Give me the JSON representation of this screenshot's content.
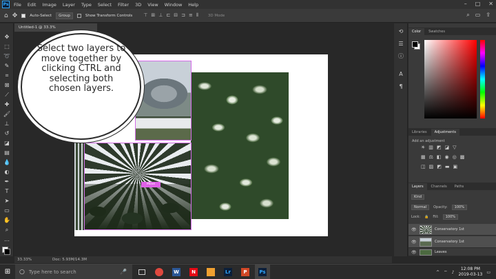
{
  "app": {
    "name": "Photoshop",
    "logo": "Ps",
    "menu": [
      "File",
      "Edit",
      "Image",
      "Layer",
      "Type",
      "Select",
      "Filter",
      "3D",
      "View",
      "Window",
      "Help"
    ],
    "window_controls": [
      "minimize",
      "maximize",
      "close"
    ]
  },
  "options_bar": {
    "auto_select_label": "Auto-Select",
    "auto_select_checked": true,
    "group_value": "Group",
    "show_transform_label": "Show Transform Controls",
    "mode_3d_label": "3D Mode"
  },
  "document": {
    "tab_title": "Untitled-1 @ 33.3%",
    "move_tag": "Move",
    "colors": {
      "selection": "#d36be8",
      "canvas": "#ffffff"
    }
  },
  "callout": {
    "text": "Select two layers to move together by clicking CTRL and selecting both chosen layers."
  },
  "status_bar": {
    "zoom": "33.33%",
    "doc_info": "Doc: 5.93M/14.3M"
  },
  "panels": {
    "color_tabs": [
      "Color",
      "Swatches"
    ],
    "adjust_tabs": [
      "Libraries",
      "Adjustments"
    ],
    "add_adjustment_label": "Add an adjustment",
    "layers_tabs": [
      "Layers",
      "Channels",
      "Paths"
    ],
    "kind_value": "Kind",
    "blend_mode": "Normal",
    "opacity_label": "Opacity:",
    "opacity_value": "100%",
    "lock_label": "Lock:",
    "fill_label": "Fill:",
    "fill_value": "100%",
    "layers": [
      {
        "name": "Conservatory 1st",
        "selected": true
      },
      {
        "name": "Conservatory 1st",
        "selected": true
      },
      {
        "name": "Leaves",
        "selected": false
      }
    ]
  },
  "taskbar": {
    "search_placeholder": "Type here to search",
    "apps": [
      {
        "icon": "chrome-icon",
        "color": "#e0483e",
        "label": ""
      },
      {
        "icon": "word-icon",
        "color": "#2b5797",
        "label": "W"
      },
      {
        "icon": "netflix-icon",
        "color": "#e50914",
        "label": "N"
      },
      {
        "icon": "files-icon",
        "color": "#f0a030",
        "label": ""
      },
      {
        "icon": "lightroom-icon",
        "color": "#0b1f3a",
        "label": "Lr"
      },
      {
        "icon": "powerpoint-icon",
        "color": "#d24726",
        "label": "P"
      },
      {
        "icon": "photoshop-icon",
        "color": "#0b1f3a",
        "label": "Ps"
      }
    ],
    "time": "12:08 PM",
    "date": "2019-03-13"
  }
}
